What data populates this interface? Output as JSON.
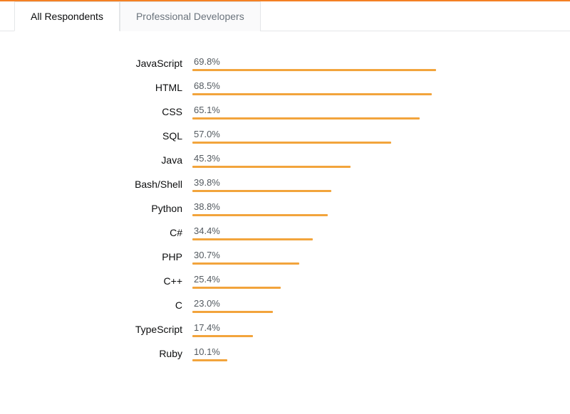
{
  "tabs": [
    {
      "label": "All Respondents",
      "active": true
    },
    {
      "label": "Professional Developers",
      "active": false
    }
  ],
  "chart_data": {
    "type": "bar",
    "categories": [
      "JavaScript",
      "HTML",
      "CSS",
      "SQL",
      "Java",
      "Bash/Shell",
      "Python",
      "C#",
      "PHP",
      "C++",
      "C",
      "TypeScript",
      "Ruby"
    ],
    "values": [
      69.8,
      68.5,
      65.1,
      57.0,
      45.3,
      39.8,
      38.8,
      34.4,
      30.7,
      25.4,
      23.0,
      17.4,
      10.1
    ],
    "value_suffix": "%",
    "xlabel": "",
    "ylabel": "",
    "xlim": [
      0,
      100
    ],
    "bar_color": "#f2a43c"
  }
}
